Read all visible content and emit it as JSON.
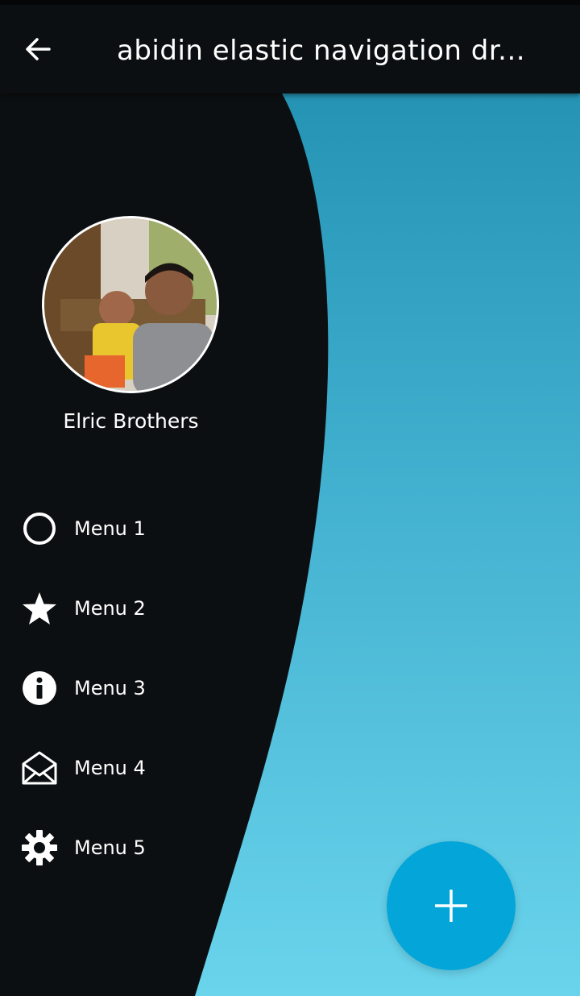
{
  "appbar": {
    "title": "abidin elastic navigation dr...",
    "back_icon": "arrow-left-icon"
  },
  "drawer": {
    "profile": {
      "name": "Elric Brothers",
      "avatar_icon": "profile-photo"
    },
    "items": [
      {
        "label": "Menu 1",
        "icon": "circle-outline-icon"
      },
      {
        "label": "Menu 2",
        "icon": "star-icon"
      },
      {
        "label": "Menu 3",
        "icon": "info-icon"
      },
      {
        "label": "Menu 4",
        "icon": "envelope-open-icon"
      },
      {
        "label": "Menu 5",
        "icon": "gear-icon"
      }
    ]
  },
  "fab": {
    "icon": "plus-icon"
  },
  "colors": {
    "drawer": "#0c0f11",
    "content_top": "#2593b4",
    "content_bottom": "#6ad4ec",
    "fab": "#04a5d9"
  }
}
